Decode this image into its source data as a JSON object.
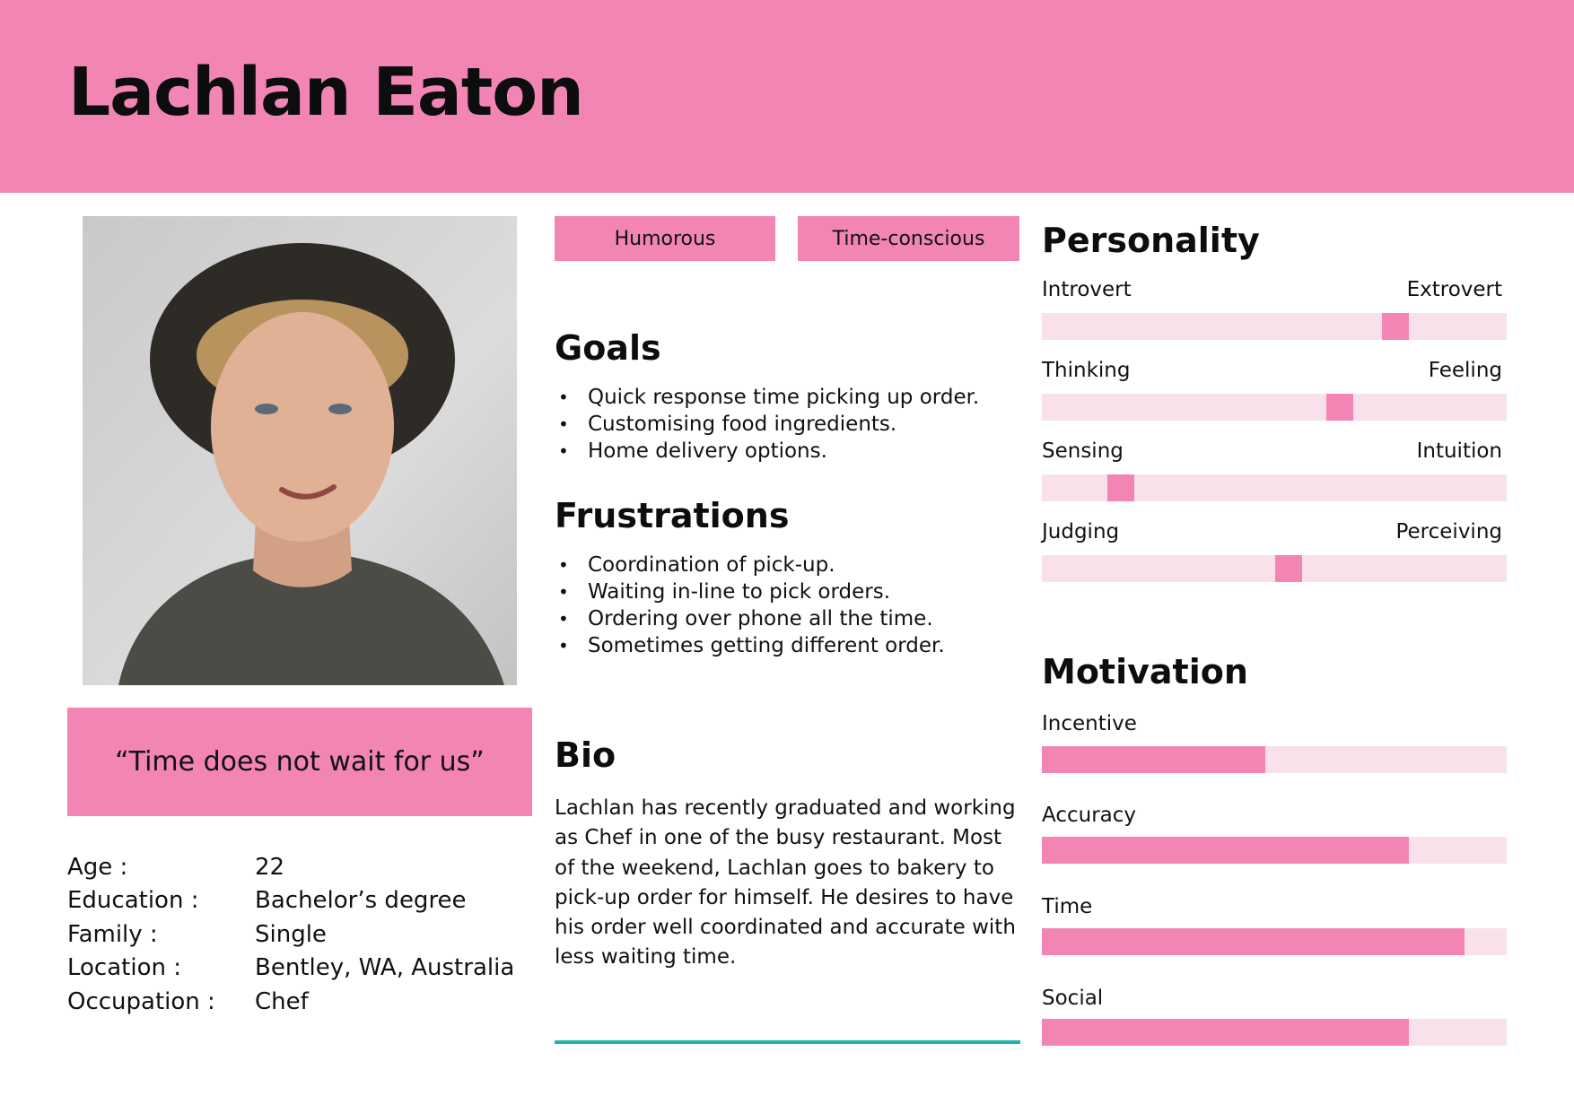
{
  "persona": {
    "name": "Lachlan Eaton",
    "quote": "“Time does not wait for us”",
    "traits": [
      "Humorous",
      "Time-conscious"
    ]
  },
  "demographics": [
    {
      "label": "Age :",
      "value": "22"
    },
    {
      "label": "Education :",
      "value": "Bachelor’s degree"
    },
    {
      "label": "Family :",
      "value": "Single"
    },
    {
      "label": "Location :",
      "value": "Bentley, WA, Australia"
    },
    {
      "label": "Occupation :",
      "value": "Chef"
    }
  ],
  "goals": {
    "title": "Goals",
    "items": [
      "Quick response time picking up order.",
      "Customising food ingredients.",
      "Home delivery options."
    ]
  },
  "frustrations": {
    "title": "Frustrations",
    "items": [
      "Coordination of pick-up.",
      "Waiting in-line to pick orders.",
      "Ordering over phone all the time.",
      "Sometimes getting different order."
    ]
  },
  "bio": {
    "title": "Bio",
    "text": "Lachlan has recently graduated and working as Chef in one of the busy restaurant. Most of the weekend, Lachlan goes to bakery to pick-up order for himself. He desires to have his order well coordinated and accurate with less waiting time."
  },
  "personality": {
    "title": "Personality",
    "scales": [
      {
        "left": "Introvert",
        "right": "Extrovert",
        "value": 0.76
      },
      {
        "left": "Thinking",
        "right": "Feeling",
        "value": 0.64
      },
      {
        "left": "Sensing",
        "right": "Intuition",
        "value": 0.17
      },
      {
        "left": "Judging",
        "right": "Perceiving",
        "value": 0.53
      }
    ]
  },
  "motivation": {
    "title": "Motivation",
    "bars": [
      {
        "label": "Incentive",
        "value": 0.48
      },
      {
        "label": "Accuracy",
        "value": 0.79
      },
      {
        "label": "Time",
        "value": 0.91
      },
      {
        "label": "Social",
        "value": 0.79
      }
    ]
  },
  "colors": {
    "accent": "#f285b4",
    "track": "#f8e1eb",
    "rule": "#1fb3aa"
  }
}
